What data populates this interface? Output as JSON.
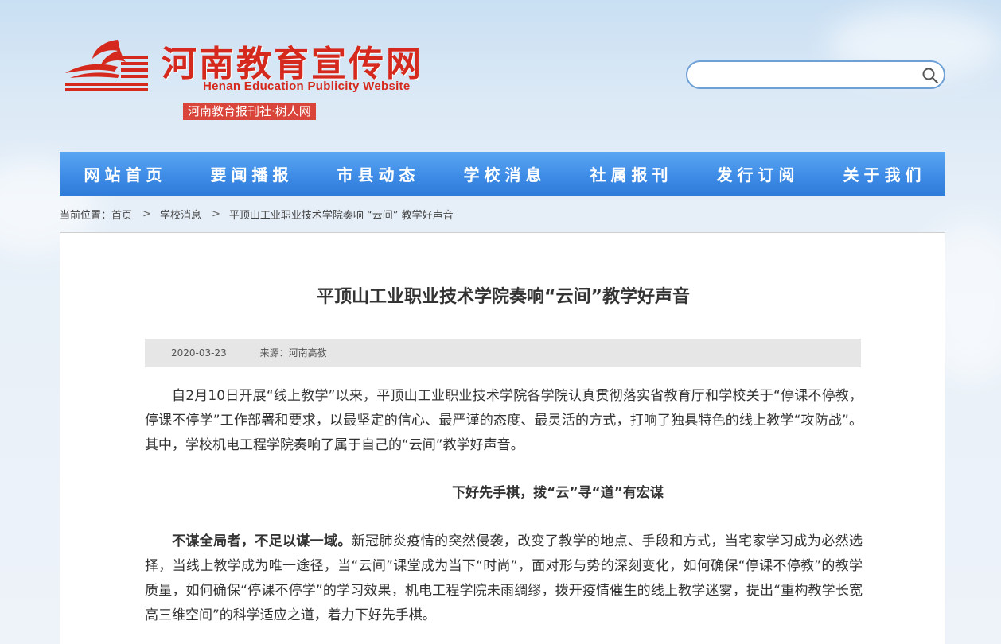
{
  "site": {
    "title": "河南教育宣传网",
    "subtitle_en": "Henan Education Publicity Website",
    "tagline": "河南教育报刊社·树人网",
    "brand_color": "#d6291d"
  },
  "search": {
    "value": "",
    "placeholder": ""
  },
  "nav": {
    "items": [
      {
        "label": "网站首页"
      },
      {
        "label": "要闻播报"
      },
      {
        "label": "市县动态"
      },
      {
        "label": "学校消息"
      },
      {
        "label": "社属报刊"
      },
      {
        "label": "发行订阅"
      },
      {
        "label": "关于我们"
      }
    ],
    "color": "#3e8ce6"
  },
  "breadcrumb": {
    "prefix": "当前位置：",
    "items": [
      "首页",
      "学校消息",
      "平顶山工业职业技术学院奏响 “云间” 教学好声音"
    ]
  },
  "article": {
    "title": "平顶山工业职业技术学院奏响“云间”教学好声音",
    "date": "2020-03-23",
    "source": "来源：河南高教",
    "para1": "自2月10日开展“线上教学”以来，平顶山工业职业技术学院各学院认真贯彻落实省教育厅和学校关于“停课不停教，停课不停学”工作部署和要求，以最坚定的信心、最严谨的态度、最灵活的方式，打响了独具特色的线上教学“攻防战”。其中，学校机电工程学院奏响了属于自己的“云间”教学好声音。",
    "heading1": "下好先手棋，拨“云”寻“道”有宏谋",
    "para2_bold": "不谋全局者，不足以谋一域。",
    "para2": "新冠肺炎疫情的突然侵袭，改变了教学的地点、手段和方式，当宅家学习成为必然选择，当线上教学成为唯一途径，当“云间”课堂成为当下“时尚”，面对形与势的深刻变化，如何确保“停课不停教”的教学质量，如何确保“停课不停学”的学习效果，机电工程学院未雨绸缪，拨开疫情催生的线上教学迷雾，提出“重构教学长宽高三维空间”的科学适应之道，着力下好先手棋。"
  }
}
